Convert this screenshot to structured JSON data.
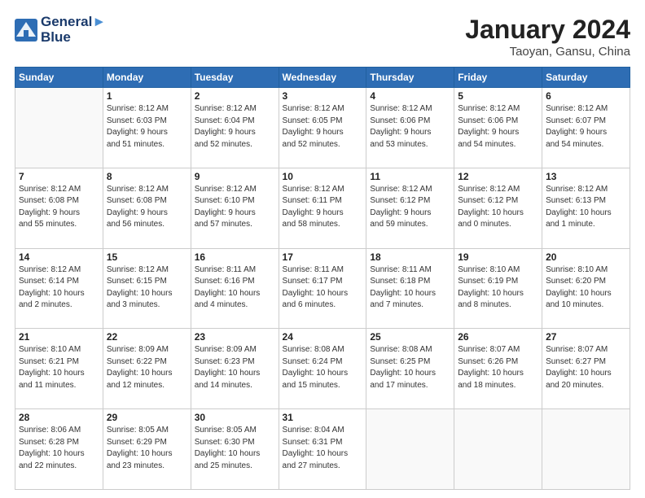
{
  "header": {
    "logo_line1": "General",
    "logo_line2": "Blue",
    "main_title": "January 2024",
    "sub_title": "Taoyan, Gansu, China"
  },
  "days_of_week": [
    "Sunday",
    "Monday",
    "Tuesday",
    "Wednesday",
    "Thursday",
    "Friday",
    "Saturday"
  ],
  "weeks": [
    [
      {
        "day": "",
        "info": ""
      },
      {
        "day": "1",
        "info": "Sunrise: 8:12 AM\nSunset: 6:03 PM\nDaylight: 9 hours\nand 51 minutes."
      },
      {
        "day": "2",
        "info": "Sunrise: 8:12 AM\nSunset: 6:04 PM\nDaylight: 9 hours\nand 52 minutes."
      },
      {
        "day": "3",
        "info": "Sunrise: 8:12 AM\nSunset: 6:05 PM\nDaylight: 9 hours\nand 52 minutes."
      },
      {
        "day": "4",
        "info": "Sunrise: 8:12 AM\nSunset: 6:06 PM\nDaylight: 9 hours\nand 53 minutes."
      },
      {
        "day": "5",
        "info": "Sunrise: 8:12 AM\nSunset: 6:06 PM\nDaylight: 9 hours\nand 54 minutes."
      },
      {
        "day": "6",
        "info": "Sunrise: 8:12 AM\nSunset: 6:07 PM\nDaylight: 9 hours\nand 54 minutes."
      }
    ],
    [
      {
        "day": "7",
        "info": ""
      },
      {
        "day": "8",
        "info": "Sunrise: 8:12 AM\nSunset: 6:08 PM\nDaylight: 9 hours\nand 56 minutes."
      },
      {
        "day": "9",
        "info": "Sunrise: 8:12 AM\nSunset: 6:10 PM\nDaylight: 9 hours\nand 57 minutes."
      },
      {
        "day": "10",
        "info": "Sunrise: 8:12 AM\nSunset: 6:11 PM\nDaylight: 9 hours\nand 58 minutes."
      },
      {
        "day": "11",
        "info": "Sunrise: 8:12 AM\nSunset: 6:12 PM\nDaylight: 9 hours\nand 59 minutes."
      },
      {
        "day": "12",
        "info": "Sunrise: 8:12 AM\nSunset: 6:12 PM\nDaylight: 10 hours\nand 0 minutes."
      },
      {
        "day": "13",
        "info": "Sunrise: 8:12 AM\nSunset: 6:13 PM\nDaylight: 10 hours\nand 1 minute."
      }
    ],
    [
      {
        "day": "14",
        "info": "Sunrise: 8:12 AM\nSunset: 6:14 PM\nDaylight: 10 hours\nand 2 minutes."
      },
      {
        "day": "15",
        "info": "Sunrise: 8:12 AM\nSunset: 6:15 PM\nDaylight: 10 hours\nand 3 minutes."
      },
      {
        "day": "16",
        "info": "Sunrise: 8:11 AM\nSunset: 6:16 PM\nDaylight: 10 hours\nand 4 minutes."
      },
      {
        "day": "17",
        "info": "Sunrise: 8:11 AM\nSunset: 6:17 PM\nDaylight: 10 hours\nand 6 minutes."
      },
      {
        "day": "18",
        "info": "Sunrise: 8:11 AM\nSunset: 6:18 PM\nDaylight: 10 hours\nand 7 minutes."
      },
      {
        "day": "19",
        "info": "Sunrise: 8:10 AM\nSunset: 6:19 PM\nDaylight: 10 hours\nand 8 minutes."
      },
      {
        "day": "20",
        "info": "Sunrise: 8:10 AM\nSunset: 6:20 PM\nDaylight: 10 hours\nand 10 minutes."
      }
    ],
    [
      {
        "day": "21",
        "info": "Sunrise: 8:10 AM\nSunset: 6:21 PM\nDaylight: 10 hours\nand 11 minutes."
      },
      {
        "day": "22",
        "info": "Sunrise: 8:09 AM\nSunset: 6:22 PM\nDaylight: 10 hours\nand 12 minutes."
      },
      {
        "day": "23",
        "info": "Sunrise: 8:09 AM\nSunset: 6:23 PM\nDaylight: 10 hours\nand 14 minutes."
      },
      {
        "day": "24",
        "info": "Sunrise: 8:08 AM\nSunset: 6:24 PM\nDaylight: 10 hours\nand 15 minutes."
      },
      {
        "day": "25",
        "info": "Sunrise: 8:08 AM\nSunset: 6:25 PM\nDaylight: 10 hours\nand 17 minutes."
      },
      {
        "day": "26",
        "info": "Sunrise: 8:07 AM\nSunset: 6:26 PM\nDaylight: 10 hours\nand 18 minutes."
      },
      {
        "day": "27",
        "info": "Sunrise: 8:07 AM\nSunset: 6:27 PM\nDaylight: 10 hours\nand 20 minutes."
      }
    ],
    [
      {
        "day": "28",
        "info": "Sunrise: 8:06 AM\nSunset: 6:28 PM\nDaylight: 10 hours\nand 22 minutes."
      },
      {
        "day": "29",
        "info": "Sunrise: 8:05 AM\nSunset: 6:29 PM\nDaylight: 10 hours\nand 23 minutes."
      },
      {
        "day": "30",
        "info": "Sunrise: 8:05 AM\nSunset: 6:30 PM\nDaylight: 10 hours\nand 25 minutes."
      },
      {
        "day": "31",
        "info": "Sunrise: 8:04 AM\nSunset: 6:31 PM\nDaylight: 10 hours\nand 27 minutes."
      },
      {
        "day": "",
        "info": ""
      },
      {
        "day": "",
        "info": ""
      },
      {
        "day": "",
        "info": ""
      }
    ]
  ],
  "week1_sunday": "Sunrise: 8:12 AM\nSunset: 6:08 PM\nDaylight: 9 hours\nand 55 minutes."
}
